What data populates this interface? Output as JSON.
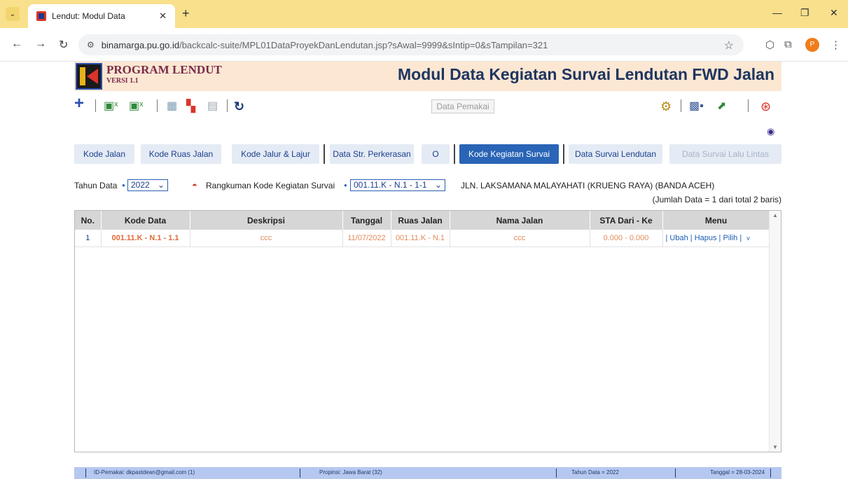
{
  "browser": {
    "tab_title": "Lendut: Modul Data",
    "url_host": "binamarga.pu.go.id",
    "url_path": "/backcalc-suite/MPL01DataProyekDanLendutan.jsp?sAwal=9999&sIntip=0&sTampilan=321",
    "profile_initial": "P"
  },
  "header": {
    "program_title": "PROGRAM LENDUT",
    "version": "VERSI 1.1",
    "module_title": "Modul Data Kegiatan Survai Lendutan FWD Jalan"
  },
  "toolbar": {
    "pemakai_label": "Data Pemakai"
  },
  "tabs": [
    {
      "label": "Kode Jalan"
    },
    {
      "label": "Kode Ruas Jalan"
    },
    {
      "label": "Kode Jalur & Lajur"
    },
    {
      "label": "Data Str. Perkerasan"
    },
    {
      "label": "O"
    },
    {
      "label": "Kode Kegiatan Survai"
    },
    {
      "label": "Data Survai Lendutan"
    },
    {
      "label": "Data Survai Lalu Lintas"
    }
  ],
  "filter": {
    "tahun_label": "Tahun Data",
    "tahun_value": "2022",
    "rangkuman_label": "Rangkuman Kode Kegiatan Survai",
    "kode_value": "001.11.K - N.1 - 1-1",
    "jalan_name": "JLN. LAKSAMANA MALAYAHATI (KRUENG RAYA) (BANDA ACEH)",
    "jumlah": "(Jumlah Data = 1 dari total 2 baris)"
  },
  "table": {
    "headers": [
      "No.",
      "Kode Data",
      "Deskripsi",
      "Tanggal",
      "Ruas Jalan",
      "Nama Jalan",
      "STA Dari - Ke",
      "Menu"
    ],
    "rows": [
      {
        "no": "1",
        "kode": "001.11.K - N.1 - 1.1",
        "deskripsi": "ccc",
        "tanggal": "11/07/2022",
        "ruas": "001.11.K - N.1",
        "nama": "ccc",
        "sta": "0.000 - 0.000",
        "menu_ubah": "Ubah",
        "menu_hapus": "Hapus",
        "menu_pilih": "Pilih",
        "menu_more": "v"
      }
    ]
  },
  "footer": {
    "id_pemakai": "ID-Pemakai: dkpastdean@gmail.com (1)",
    "propinsi": "Propinsi: Jawa Barat (32)",
    "tahun": "Tahun Data = 2022",
    "tanggal": "Tanggal = 28-03-2024"
  }
}
